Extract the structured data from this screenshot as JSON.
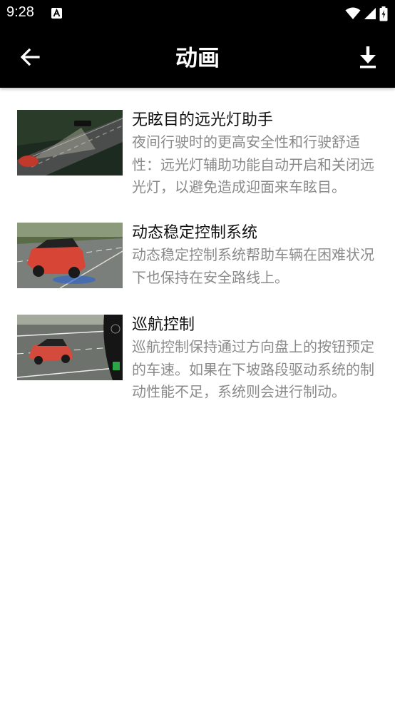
{
  "status_bar": {
    "time": "9:28"
  },
  "app_bar": {
    "title": "动画"
  },
  "items": [
    {
      "title": "无眩目的远光灯助手",
      "description": "夜间行驶时的更高安全性和行驶舒适性：远光灯辅助功能自动开启和关闭远光灯，以避免造成迎面来车眩目。"
    },
    {
      "title": "动态稳定控制系统",
      "description": "动态稳定控制系统帮助车辆在困难状况下也保持在安全路线上。"
    },
    {
      "title": "巡航控制",
      "description": "巡航控制保持通过方向盘上的按钮预定的车速。如果在下坡路段驱动系统的制动性能不足，系统则会进行制动。"
    }
  ]
}
